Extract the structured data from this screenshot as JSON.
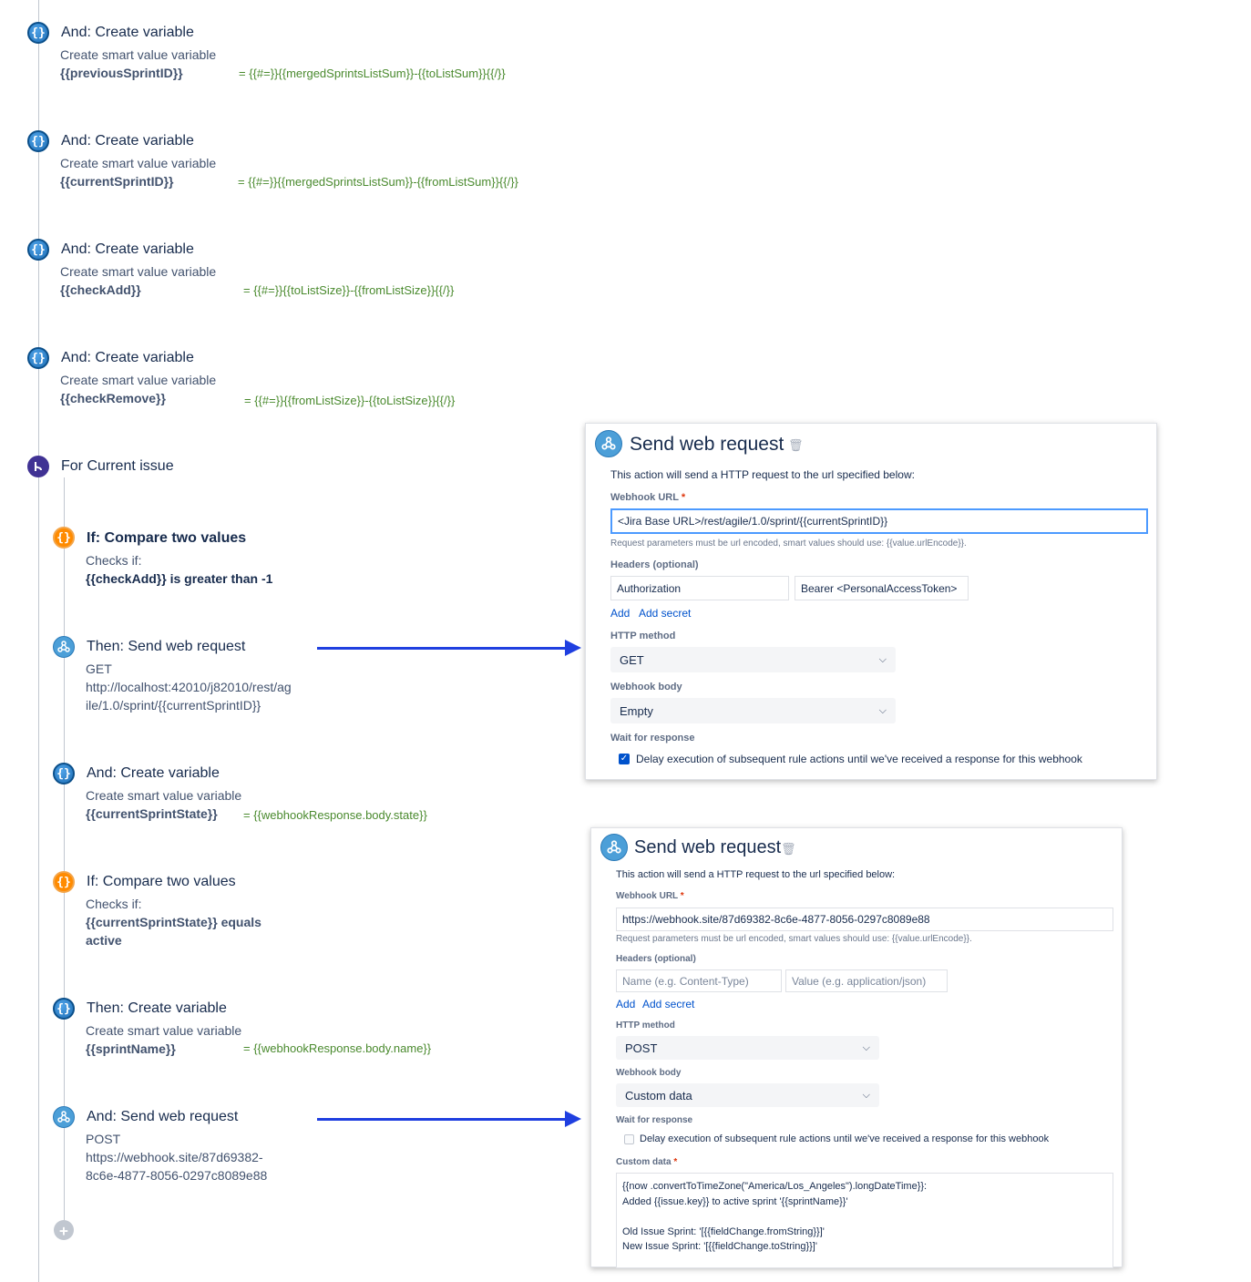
{
  "rule_steps": [
    {
      "title": "And: Create variable",
      "subtitle": "Create smart value variable",
      "variable": "{{previousSprintID}}",
      "value": "= {{#=}}{{mergedSprintsListSum}}-{{toListSum}}{{/}}"
    },
    {
      "title": "And: Create variable",
      "subtitle": "Create smart value variable",
      "variable": "{{currentSprintID}}",
      "value": "= {{#=}}{{mergedSprintsListSum}}-{{fromListSum}}{{/}}"
    },
    {
      "title": "And: Create variable",
      "subtitle": "Create smart value variable",
      "variable": "{{checkAdd}}",
      "value": "= {{#=}}{{toListSize}}-{{fromListSize}}{{/}}"
    },
    {
      "title": "And: Create variable",
      "subtitle": "Create smart value variable",
      "variable": "{{checkRemove}}",
      "value": "= {{#=}}{{fromListSize}}-{{toListSize}}{{/}}"
    }
  ],
  "branch": {
    "title": "For Current issue"
  },
  "branch_steps": {
    "if1": {
      "title": "If: Compare two values",
      "subtitle": "Checks if:",
      "condition": "{{checkAdd}} is greater than -1"
    },
    "then_web": {
      "title": "Then: Send web request",
      "method": "GET",
      "url_line1": "http://localhost:42010/j82010/rest/ag",
      "url_line2": "ile/1.0/sprint/{{currentSprintID}}"
    },
    "and_var": {
      "title": "And: Create variable",
      "subtitle": "Create smart value variable",
      "variable": "{{currentSprintState}}",
      "value": "= {{webhookResponse.body.state}}"
    },
    "if2": {
      "title": "If: Compare two values",
      "subtitle": "Checks if:",
      "condition_line1": "{{currentSprintState}} equals",
      "condition_line2": "active"
    },
    "then_var": {
      "title": "Then: Create variable",
      "subtitle": "Create smart value variable",
      "variable": "{{sprintName}}",
      "value": "= {{webhookResponse.body.name}}"
    },
    "and_web": {
      "title": "And: Send web request",
      "method": "POST",
      "url_line1": "https://webhook.site/87d69382-",
      "url_line2": "8c6e-4877-8056-0297c8089e88"
    }
  },
  "panel1": {
    "title": "Send web request",
    "description": "This action will send a HTTP request to the url specified below:",
    "url_label": "Webhook URL",
    "url_value": "<Jira Base URL>/rest/agile/1.0/sprint/{{currentSprintID}}",
    "url_help": "Request parameters must be url encoded, smart values should use: {{value.urlEncode}}.",
    "headers_label": "Headers (optional)",
    "header_name": "Authorization",
    "header_value": "Bearer <PersonalAccessToken>",
    "add_link": "Add",
    "add_secret_link": "Add secret",
    "method_label": "HTTP method",
    "method_value": "GET",
    "body_label": "Webhook body",
    "body_value": "Empty",
    "wait_label": "Wait for response",
    "wait_text": "Delay execution of subsequent rule actions until we've received a response for this webhook",
    "wait_checked": true
  },
  "panel2": {
    "title": "Send web request",
    "description": "This action will send a HTTP request to the url specified below:",
    "url_label": "Webhook URL",
    "url_value": "https://webhook.site/87d69382-8c6e-4877-8056-0297c8089e88",
    "url_help": "Request parameters must be url encoded, smart values should use: {{value.urlEncode}}.",
    "headers_label": "Headers (optional)",
    "header_name_placeholder": "Name (e.g. Content-Type)",
    "header_value_placeholder": "Value (e.g. application/json)",
    "add_link": "Add",
    "add_secret_link": "Add secret",
    "method_label": "HTTP method",
    "method_value": "POST",
    "body_label": "Webhook body",
    "body_value": "Custom data",
    "wait_label": "Wait for response",
    "wait_text": "Delay execution of subsequent rule actions until we've received a response for this webhook",
    "wait_checked": false,
    "custom_label": "Custom data",
    "custom_lines": [
      "{{now .convertToTimeZone(\"America/Los_Angeles\").longDateTime}}:",
      "Added {{issue.key}} to active sprint '{{sprintName}}'",
      "",
      "Old Issue Sprint: '[{{fieldChange.fromString}}]'",
      "New Issue Sprint: '[{{fieldChange.toString}}]'"
    ]
  },
  "icons": {
    "variable": "curly-braces-icon",
    "condition": "condition-braces-icon",
    "branch": "branch-icon",
    "webhook": "webhook-icon",
    "add": "plus-icon",
    "delete": "trash-icon",
    "dropdown": "chevron-down-icon"
  },
  "colors": {
    "arrow": "#1f3fe0",
    "expression": "#4a8a2e",
    "link": "#0052CC"
  }
}
